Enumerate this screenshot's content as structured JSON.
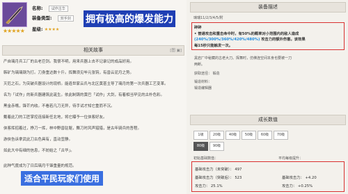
{
  "weapon": {
    "icon": "sword-icon",
    "stars": "★★★★★",
    "name_label": "名称:",
    "name_value": "试作古华",
    "type_label": "装备类型:",
    "type_value": "双手剑",
    "rarity_label": "星级:"
  },
  "banner_top": "拥有极高的爆发能力",
  "banner_bottom": "适合平民玩家们使用",
  "story": {
    "heading": "相关故事",
    "icons": "[图 ▣]",
    "lines": [
      "产自璃月兵工厂的古老巨剑。我很不明，用来兵器上去不记录记的成品好用。",
      "韩矿为璃璃钢为打。刀身重达数十斤。挥舞须见毕元张钩，有兽云泥月之势。",
      "灭厄之石，为突破兵器设计的现桥。能造世家云氏与北区黄甚主导了璃月的第一次兵器工艺变革。",
      "名为「试作」的新兵器建筑此诞生。依此制铸的黄巴「试作」大剑，有着相当罕见的古朴色彩。",
      "黑金赤嘴，锋芒内收。不看若凡刀无异，待手试才知它重而不沉。",
      "戴着此刀的工匠掌控连接新任北地，将它曝予一位侠客好友。",
      "侠客挥招着过，挣刀一挥，林中野兽驻躯，舞刀时风声猎猎，是古年骑兵的吾程。",
      "游侠告诉拿武此刀古色具有，直动宜静。",
      "如此大中有细的信息，不妨始之「古华」。",
      "此种气度成为了日后璃月千锋重量的规范。"
    ]
  },
  "desc": {
    "heading": "装备描述",
    "meta": "璃瑞11/2/3/4/5/附",
    "effect_title": "碎碎",
    "effect_line1": "• 普通攻击和重击命中时，有50%的概率对小范围内的敌人造成",
    "effect_values": "(240%/300%/360%/420%/480%)",
    "effect_line1b": "攻击力的额外伤害。该效果",
    "effect_line2": "每15秒只能触发一次。",
    "flavor1": "黑岩厂中秘藏的古老大刀。挥舞时，仿佛连空间本身也要被一刀",
    "flavor2": "两断。",
    "source_label": "获取途径：",
    "source_value": "锻造",
    "refine_label": "锻造材料：",
    "refine_value": "锻造编辑器"
  },
  "growth": {
    "heading": "成长数值",
    "levels": [
      "1级",
      "20级",
      "40级",
      "50级",
      "60级",
      "70级",
      "80级",
      "90级"
    ],
    "selected": "80级",
    "col_base": "初始基础数值：",
    "col_ascend": "平均每级提升：",
    "base_atk_label": "基础攻击力（未突破）：",
    "base_atk_value": "497",
    "base_atk2_label": "基础攻击力（突破后）：",
    "base_atk2_value": "523",
    "sub_label": "攻击力：",
    "sub_value": "25.1%",
    "inc_atk_label": "基础攻击力：",
    "inc_atk_value": "+4.20",
    "inc_sub_label": "攻击力：",
    "inc_sub_value": "+0.25%"
  },
  "colors": {
    "banner_dark": "#1f3fb4",
    "banner_light": "#3a6fe0",
    "highlight_box": "#d93030",
    "percent_text": "#1a8ae0"
  }
}
